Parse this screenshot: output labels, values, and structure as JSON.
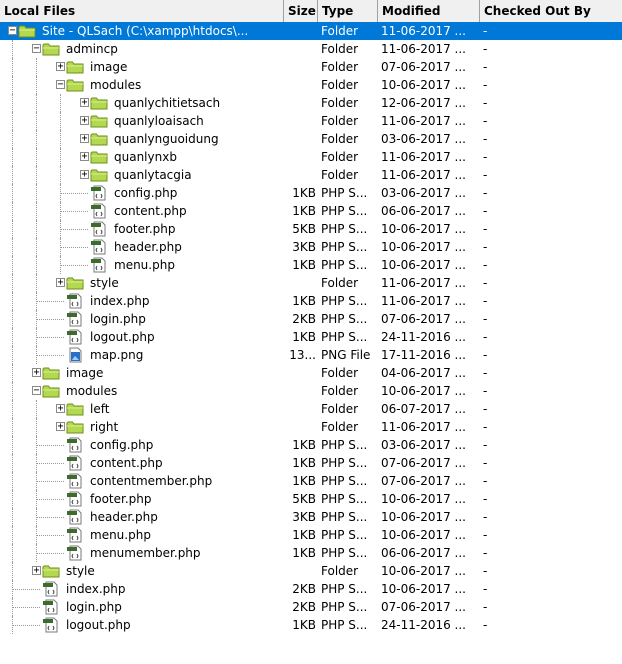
{
  "columns": {
    "local_files": "Local Files",
    "size": "Size",
    "type": "Type",
    "modified": "Modified",
    "checked_out_by": "Checked Out By"
  },
  "rows": [
    {
      "depth": 0,
      "kind": "folder",
      "expanded": true,
      "name": "Site - QLSach (C:\\xampp\\htdocs\\...",
      "size": "",
      "type": "Folder",
      "modified": "11-06-2017 ...",
      "checked": "-",
      "selected": true
    },
    {
      "depth": 1,
      "kind": "folder",
      "expanded": true,
      "name": "admincp",
      "size": "",
      "type": "Folder",
      "modified": "11-06-2017 ...",
      "checked": "-"
    },
    {
      "depth": 2,
      "kind": "folder",
      "expanded": false,
      "name": "image",
      "size": "",
      "type": "Folder",
      "modified": "07-06-2017 ...",
      "checked": "-"
    },
    {
      "depth": 2,
      "kind": "folder",
      "expanded": true,
      "name": "modules",
      "size": "",
      "type": "Folder",
      "modified": "10-06-2017 ...",
      "checked": "-"
    },
    {
      "depth": 3,
      "kind": "folder",
      "expanded": false,
      "name": "quanlychitietsach",
      "size": "",
      "type": "Folder",
      "modified": "12-06-2017 ...",
      "checked": "-"
    },
    {
      "depth": 3,
      "kind": "folder",
      "expanded": false,
      "name": "quanlyloaisach",
      "size": "",
      "type": "Folder",
      "modified": "11-06-2017 ...",
      "checked": "-"
    },
    {
      "depth": 3,
      "kind": "folder",
      "expanded": false,
      "name": "quanlynguoidung",
      "size": "",
      "type": "Folder",
      "modified": "03-06-2017 ...",
      "checked": "-"
    },
    {
      "depth": 3,
      "kind": "folder",
      "expanded": false,
      "name": "quanlynxb",
      "size": "",
      "type": "Folder",
      "modified": "11-06-2017 ...",
      "checked": "-"
    },
    {
      "depth": 3,
      "kind": "folder",
      "expanded": false,
      "name": "quanlytacgia",
      "size": "",
      "type": "Folder",
      "modified": "11-06-2017 ...",
      "checked": "-"
    },
    {
      "depth": 3,
      "kind": "php",
      "name": "config.php",
      "size": "1KB",
      "type": "PHP S...",
      "modified": "03-06-2017 ...",
      "checked": "-"
    },
    {
      "depth": 3,
      "kind": "php",
      "name": "content.php",
      "size": "1KB",
      "type": "PHP S...",
      "modified": "06-06-2017 ...",
      "checked": "-"
    },
    {
      "depth": 3,
      "kind": "php",
      "name": "footer.php",
      "size": "5KB",
      "type": "PHP S...",
      "modified": "10-06-2017 ...",
      "checked": "-"
    },
    {
      "depth": 3,
      "kind": "php",
      "name": "header.php",
      "size": "3KB",
      "type": "PHP S...",
      "modified": "10-06-2017 ...",
      "checked": "-"
    },
    {
      "depth": 3,
      "kind": "php",
      "name": "menu.php",
      "size": "1KB",
      "type": "PHP S...",
      "modified": "10-06-2017 ...",
      "checked": "-"
    },
    {
      "depth": 2,
      "kind": "folder",
      "expanded": false,
      "name": "style",
      "size": "",
      "type": "Folder",
      "modified": "11-06-2017 ...",
      "checked": "-"
    },
    {
      "depth": 2,
      "kind": "php",
      "name": "index.php",
      "size": "1KB",
      "type": "PHP S...",
      "modified": "11-06-2017 ...",
      "checked": "-"
    },
    {
      "depth": 2,
      "kind": "php",
      "name": "login.php",
      "size": "2KB",
      "type": "PHP S...",
      "modified": "07-06-2017 ...",
      "checked": "-"
    },
    {
      "depth": 2,
      "kind": "php",
      "name": "logout.php",
      "size": "1KB",
      "type": "PHP S...",
      "modified": "24-11-2016 ...",
      "checked": "-"
    },
    {
      "depth": 2,
      "kind": "png",
      "name": "map.png",
      "size": "13...",
      "type": "PNG File",
      "modified": "17-11-2016 ...",
      "checked": "-"
    },
    {
      "depth": 1,
      "kind": "folder",
      "expanded": false,
      "name": "image",
      "size": "",
      "type": "Folder",
      "modified": "04-06-2017 ...",
      "checked": "-"
    },
    {
      "depth": 1,
      "kind": "folder",
      "expanded": true,
      "name": "modules",
      "size": "",
      "type": "Folder",
      "modified": "10-06-2017 ...",
      "checked": "-"
    },
    {
      "depth": 2,
      "kind": "folder",
      "expanded": false,
      "name": "left",
      "size": "",
      "type": "Folder",
      "modified": "06-07-2017 ...",
      "checked": "-"
    },
    {
      "depth": 2,
      "kind": "folder",
      "expanded": false,
      "name": "right",
      "size": "",
      "type": "Folder",
      "modified": "11-06-2017 ...",
      "checked": "-"
    },
    {
      "depth": 2,
      "kind": "php",
      "name": "config.php",
      "size": "1KB",
      "type": "PHP S...",
      "modified": "03-06-2017 ...",
      "checked": "-"
    },
    {
      "depth": 2,
      "kind": "php",
      "name": "content.php",
      "size": "1KB",
      "type": "PHP S...",
      "modified": "07-06-2017 ...",
      "checked": "-"
    },
    {
      "depth": 2,
      "kind": "php",
      "name": "contentmember.php",
      "size": "1KB",
      "type": "PHP S...",
      "modified": "07-06-2017 ...",
      "checked": "-"
    },
    {
      "depth": 2,
      "kind": "php",
      "name": "footer.php",
      "size": "5KB",
      "type": "PHP S...",
      "modified": "10-06-2017 ...",
      "checked": "-"
    },
    {
      "depth": 2,
      "kind": "php",
      "name": "header.php",
      "size": "3KB",
      "type": "PHP S...",
      "modified": "10-06-2017 ...",
      "checked": "-"
    },
    {
      "depth": 2,
      "kind": "php",
      "name": "menu.php",
      "size": "1KB",
      "type": "PHP S...",
      "modified": "10-06-2017 ...",
      "checked": "-"
    },
    {
      "depth": 2,
      "kind": "php",
      "name": "menumember.php",
      "size": "1KB",
      "type": "PHP S...",
      "modified": "06-06-2017 ...",
      "checked": "-"
    },
    {
      "depth": 1,
      "kind": "folder",
      "expanded": false,
      "name": "style",
      "size": "",
      "type": "Folder",
      "modified": "10-06-2017 ...",
      "checked": "-"
    },
    {
      "depth": 1,
      "kind": "php",
      "name": "index.php",
      "size": "2KB",
      "type": "PHP S...",
      "modified": "10-06-2017 ...",
      "checked": "-"
    },
    {
      "depth": 1,
      "kind": "php",
      "name": "login.php",
      "size": "2KB",
      "type": "PHP S...",
      "modified": "07-06-2017 ...",
      "checked": "-"
    },
    {
      "depth": 1,
      "kind": "php",
      "name": "logout.php",
      "size": "1KB",
      "type": "PHP S...",
      "modified": "24-11-2016 ...",
      "checked": "-"
    }
  ],
  "colors": {
    "selection": "#0078d7",
    "folder": "#b4d84e",
    "folder_edge": "#6e8f1e",
    "php_bar": "#3c6b2a"
  }
}
